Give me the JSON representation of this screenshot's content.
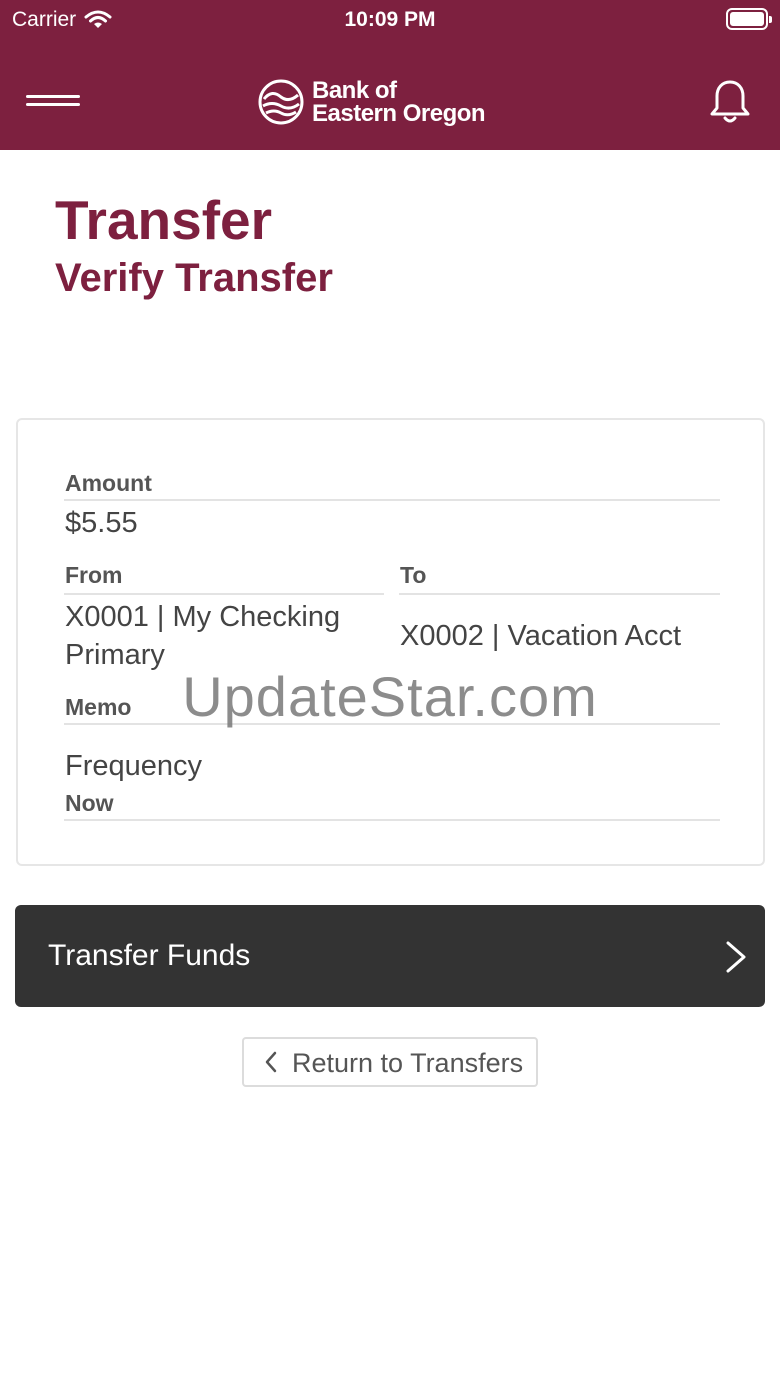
{
  "status_bar": {
    "carrier": "Carrier",
    "time": "10:09 PM"
  },
  "header": {
    "brand_line1": "Bank of",
    "brand_line2": "Eastern Oregon",
    "menu_icon": "hamburger-menu-icon",
    "notification_icon": "bell-icon"
  },
  "page": {
    "title": "Transfer",
    "subtitle": "Verify Transfer"
  },
  "details": {
    "amount_label": "Amount",
    "amount_value": "$5.55",
    "from_label": "From",
    "from_value_line1": "X0001 | My Checking",
    "from_value_line2": "Primary",
    "to_label": "To",
    "to_value": "X0002 | Vacation Acct",
    "memo_label": "Memo",
    "frequency_label": "Frequency",
    "frequency_value": "Now"
  },
  "watermark": "UpdateStar.com",
  "actions": {
    "transfer_label": "Transfer Funds",
    "return_label": "Return to Transfers"
  },
  "colors": {
    "brand": "#7d203f",
    "button_dark": "#333333"
  }
}
